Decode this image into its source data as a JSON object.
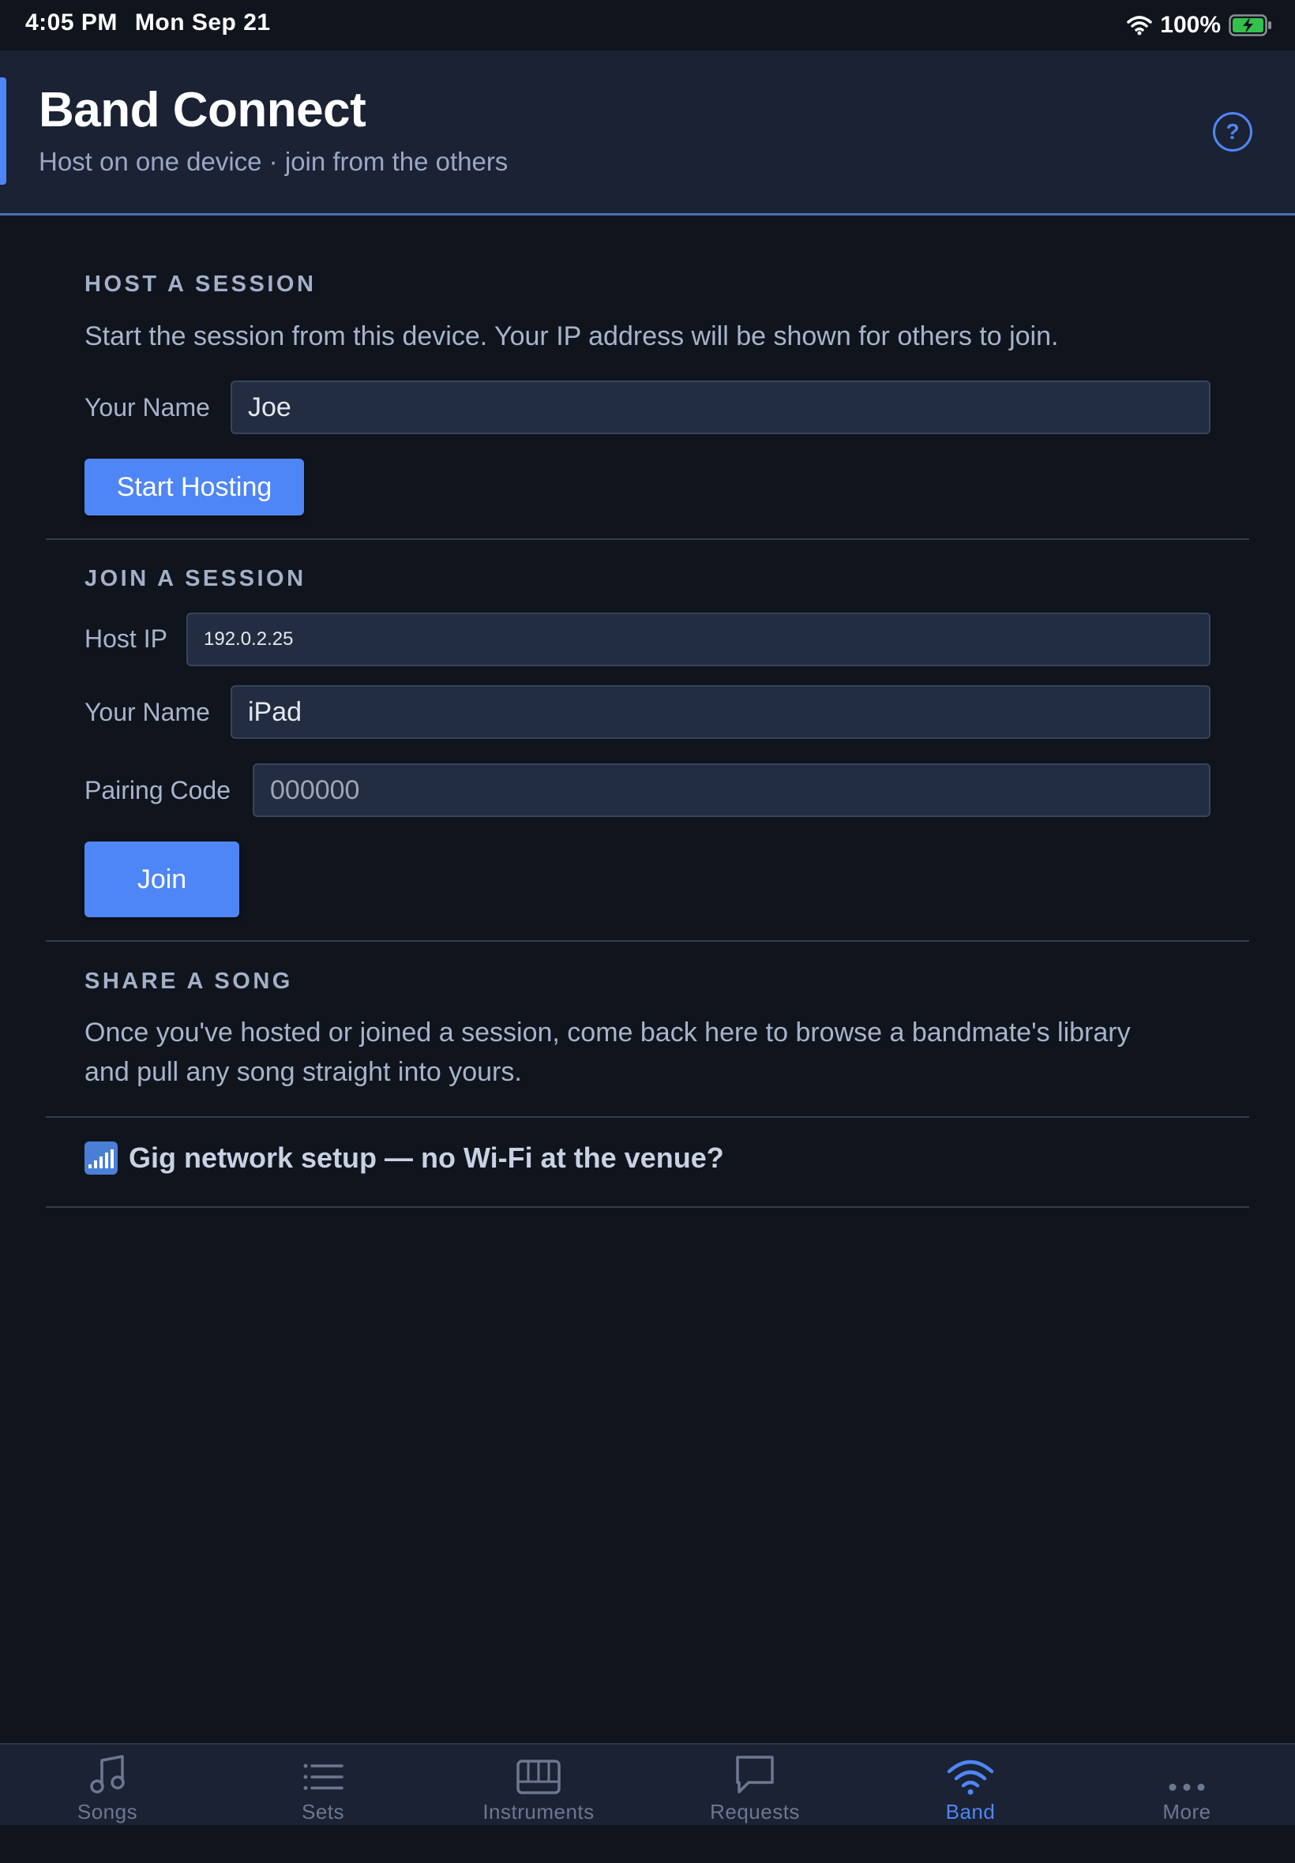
{
  "status_bar": {
    "time": "4:05 PM",
    "date": "Mon Sep 21",
    "battery": "100%"
  },
  "header": {
    "title": "Band Connect",
    "subtitle": "Host on one device · join from the others",
    "help_label": "?"
  },
  "host": {
    "title": "HOST A SESSION",
    "description": "Start the session from this device. Your IP address will be shown for others to join.",
    "name_label": "Your Name",
    "name_value": "Joe",
    "button_label": "Start Hosting"
  },
  "join": {
    "title": "JOIN A SESSION",
    "host_ip_label": "Host IP",
    "host_ip_value": "192.0.2.25",
    "name_label": "Your Name",
    "name_value": "iPad",
    "pairing_label": "Pairing Code",
    "pairing_placeholder": "000000",
    "button_label": "Join"
  },
  "share": {
    "title": "SHARE A SONG",
    "line1": "Once you've hosted or joined a session, come back here to browse a bandmate's library",
    "line2": "and pull any song straight into yours."
  },
  "gig": {
    "label": "Gig network setup — no Wi-Fi at the venue?",
    "icon": "signal-bars-icon"
  },
  "tabs": [
    {
      "label": "Songs",
      "icon": "music-note-icon"
    },
    {
      "label": "Sets",
      "icon": "list-icon"
    },
    {
      "label": "Instruments",
      "icon": "piano-keys-icon"
    },
    {
      "label": "Requests",
      "icon": "speech-bubble-icon"
    },
    {
      "label": "Band",
      "icon": "wifi-icon",
      "active": true
    },
    {
      "label": "More",
      "icon": "ellipsis-icon"
    }
  ],
  "colors": {
    "accent": "#4f86f7",
    "background": "#10141d",
    "header": "#1a2234",
    "battery": "#33c24d"
  }
}
